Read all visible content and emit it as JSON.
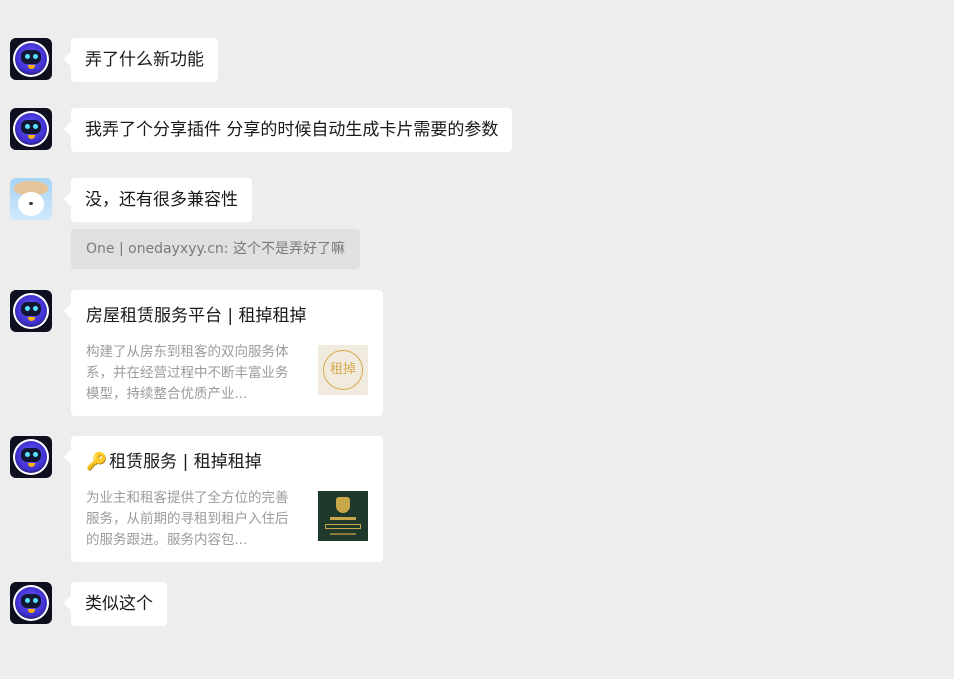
{
  "messages": [
    {
      "text": "弄了什么新功能"
    },
    {
      "text": "我弄了个分享插件 分享的时候自动生成卡片需要的参数"
    },
    {
      "text": "没，还有很多兼容性",
      "quote": "One | onedayxyy.cn: 这个不是弄好了嘛"
    },
    {
      "card": {
        "title": "房屋租赁服务平台 | 租掉租掉",
        "desc": "构建了从房东到租客的双向服务体系，并在经营过程中不断丰富业务模型，持续整合优质产业...",
        "thumb_glyph": "租掉"
      }
    },
    {
      "card": {
        "title": "租赁服务 | 租掉租掉",
        "title_icon": "🔑",
        "desc": "为业主和租客提供了全方位的完善服务，从前期的寻租到租户入住后的服务跟进。服务内容包..."
      }
    },
    {
      "text": "类似这个"
    }
  ],
  "icons": {
    "bot_avatar": "robot-avatar-icon",
    "user_avatar": "bear-avatar-icon",
    "key": "key-icon"
  },
  "colors": {
    "background": "#ededed",
    "bubble": "#ffffff",
    "quote": "#e0e0e0",
    "text": "#191919",
    "muted": "#9b9b9b"
  }
}
